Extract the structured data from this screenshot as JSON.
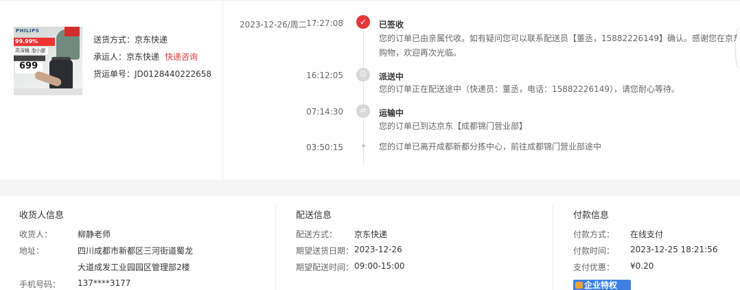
{
  "product": {
    "image_alt": "product-thumbnail",
    "brand": "PHILIPS",
    "promo_percent": "99.99%",
    "promo_tag": "高深桶 泡小腿",
    "price": "699"
  },
  "shipping_summary": {
    "method_label": "送货方式：",
    "method_value": "京东快递",
    "carrier_label": "承运人：",
    "carrier_value": "京东快递",
    "carrier_link": "快递咨询",
    "tracking_label": "货运单号：",
    "tracking_value": "JD0128440222658"
  },
  "timeline": {
    "date": "2023-12-26/周二",
    "events": [
      {
        "time": "17:27:08",
        "status": "已签收",
        "desc_line1": "您的订单已由亲属代收。如有疑问您可以联系配送员【董丞，15882226149】确认。感谢您在京东",
        "desc_line2": "购物，欢迎再次光临。"
      },
      {
        "time": "16:12:05",
        "status": "派送中",
        "desc_line1": "您的订单正在配送途中（快递员：董丞，电话：15882226149），请您耐心等待。"
      },
      {
        "time": "07:14:30",
        "status": "运输中",
        "desc_line1": "您的订单已到达京东【成都锦门营业部】"
      },
      {
        "time": "03:50:15",
        "desc_line1": "您的订单已离开成都新都分拣中心，前往成都锦门营业部途中"
      }
    ]
  },
  "receiver": {
    "title": "收货人信息",
    "name_label": "收货人：",
    "name_value": "柳静老师",
    "address_label": "地址：",
    "address_line1": "四川成都市新都区三河街道蜀龙",
    "address_line2": "大道成发工业园园区管理部2楼",
    "phone_label": "手机号码：",
    "phone_value": "137****3177"
  },
  "delivery": {
    "title": "配送信息",
    "method_label": "配送方式：",
    "method_value": "京东快递",
    "date_label": "期望送货日期：",
    "date_value": "2023-12-26",
    "time_label": "期望配送时间：",
    "time_value": "09:00-15:00"
  },
  "payment": {
    "title": "付款信息",
    "method_label": "付款方式：",
    "method_value": "在线支付",
    "time_label": "付款时间：",
    "time_value": "2023-12-25 18:21:56",
    "discount_label": "支付优惠：",
    "discount_value": "¥0.20",
    "badge_label": "企业特权"
  },
  "colors": {
    "accent_red": "#e4393c",
    "badge_blue": "#3e7fe4",
    "timeline_grey": "#d8d8d8"
  },
  "icons": {
    "signed": "check-circle-icon",
    "delivering": "courier-icon",
    "transit": "truck-icon"
  }
}
